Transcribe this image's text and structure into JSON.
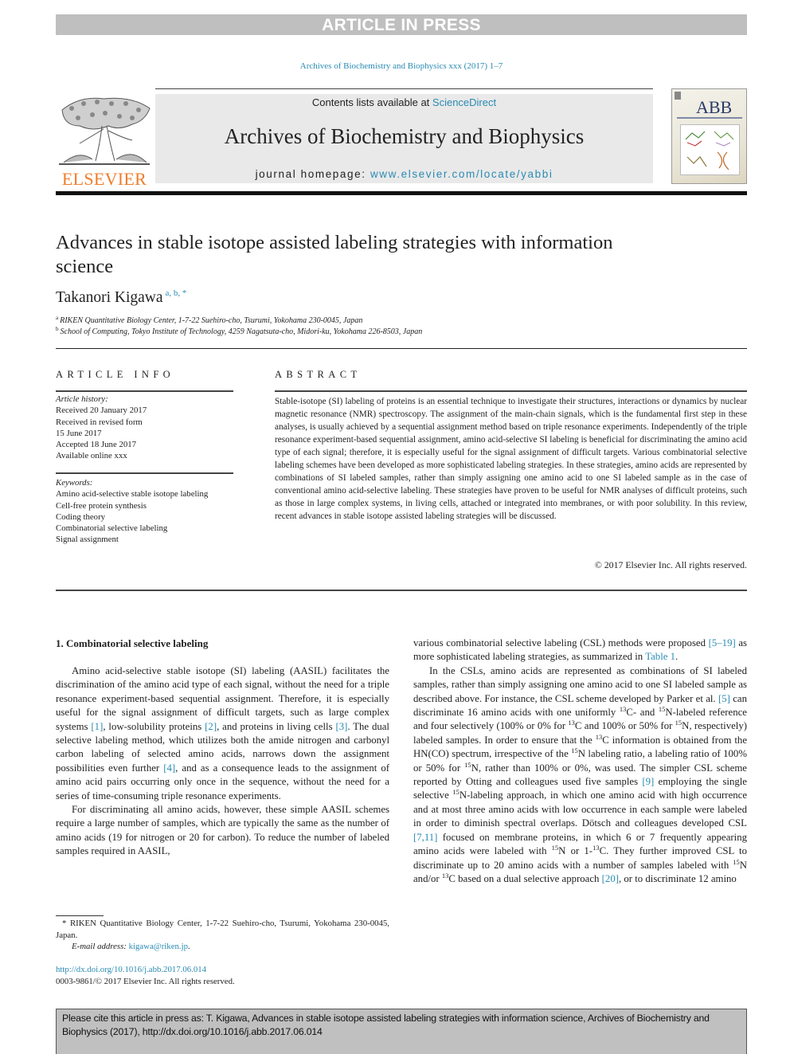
{
  "banner": {
    "text": "ARTICLE IN PRESS"
  },
  "journal_ref": "Archives of Biochemistry and Biophysics xxx (2017) 1–7",
  "header": {
    "contents_prefix": "Contents lists available at ",
    "contents_link": "ScienceDirect",
    "journal_name": "Archives of Biochemistry and Biophysics",
    "homepage_prefix": "journal homepage: ",
    "homepage_link": "www.elsevier.com/locate/yabbi",
    "publisher_logo_text": "ELSEVIER",
    "cover_title": "ABB"
  },
  "article": {
    "title": "Advances in stable isotope assisted labeling strategies with information science",
    "author": "Takanori Kigawa",
    "author_marks": "a, b, *",
    "affiliations": [
      {
        "mark": "a",
        "text": "RIKEN Quantitative Biology Center, 1-7-22 Suehiro-cho, Tsurumi, Yokohama 230-0045, Japan"
      },
      {
        "mark": "b",
        "text": "School of Computing, Tokyo Institute of Technology, 4259 Nagatsuta-cho, Midori-ku, Yokohama 226-8503, Japan"
      }
    ]
  },
  "article_info": {
    "heading": "ARTICLE INFO",
    "history_label": "Article history:",
    "history": [
      "Received 20 January 2017",
      "Received in revised form",
      "15 June 2017",
      "Accepted 18 June 2017",
      "Available online xxx"
    ],
    "keywords_label": "Keywords:",
    "keywords": [
      "Amino acid-selective stable isotope labeling",
      "Cell-free protein synthesis",
      "Coding theory",
      "Combinatorial selective labeling",
      "Signal assignment"
    ]
  },
  "abstract": {
    "heading": "ABSTRACT",
    "text": "Stable-isotope (SI) labeling of proteins is an essential technique to investigate their structures, interactions or dynamics by nuclear magnetic resonance (NMR) spectroscopy. The assignment of the main-chain signals, which is the fundamental first step in these analyses, is usually achieved by a sequential assignment method based on triple resonance experiments. Independently of the triple resonance experiment-based sequential assignment, amino acid-selective SI labeling is beneficial for discriminating the amino acid type of each signal; therefore, it is especially useful for the signal assignment of difficult targets. Various combinatorial selective labeling schemes have been developed as more sophisticated labeling strategies. In these strategies, amino acids are represented by combinations of SI labeled samples, rather than simply assigning one amino acid to one SI labeled sample as in the case of conventional amino acid-selective labeling. These strategies have proven to be useful for NMR analyses of difficult proteins, such as those in large complex systems, in living cells, attached or integrated into membranes, or with poor solubility. In this review, recent advances in stable isotope assisted labeling strategies will be discussed.",
    "copyright": "© 2017 Elsevier Inc. All rights reserved."
  },
  "section1": {
    "title": "1.  Combinatorial selective labeling",
    "left": {
      "p1_a": "Amino acid-selective stable isotope (SI) labeling (AASIL) facilitates the discrimination of the amino acid type of each signal, without the need for a triple resonance experiment-based sequential assignment. Therefore, it is especially useful for the signal assignment of difficult targets, such as large complex systems ",
      "ref1": "[1]",
      "p1_b": ", low-solubility proteins ",
      "ref2": "[2]",
      "p1_c": ", and proteins in living cells ",
      "ref3": "[3]",
      "p1_d": ". The dual selective labeling method, which utilizes both the amide nitrogen and carbonyl carbon labeling of selected amino acids, narrows down the assignment possibilities even further ",
      "ref4": "[4]",
      "p1_e": ", and as a consequence leads to the assignment of amino acid pairs occurring only once in the sequence, without the need for a series of time-consuming triple resonance experiments.",
      "p2": "For discriminating all amino acids, however, these simple AASIL schemes require a large number of samples, which are typically the same as the number of amino acids (19 for nitrogen or 20 for carbon). To reduce the number of labeled samples required in AASIL,"
    },
    "right": {
      "p1_a": "various combinatorial selective labeling (CSL) methods were proposed ",
      "ref5_19": "[5–19]",
      "p1_b": " as more sophisticated labeling strategies, as summarized in ",
      "table1": "Table 1",
      "p1_c": ".",
      "p2_a": "In the CSLs, amino acids are represented as combinations of SI labeled samples, rather than simply assigning one amino acid to one SI labeled sample as described above. For instance, the CSL scheme developed by Parker et al. ",
      "ref5": "[5]",
      "p2_b": " can discriminate 16 amino acids with one uniformly ",
      "p2_c": "C- and ",
      "p2_d": "N-labeled reference and four selectively (100% or 0% for ",
      "p2_e": "C and 100% or 50% for ",
      "p2_f": "N, respectively) labeled samples. In order to ensure that the ",
      "p2_g": "C information is obtained from the HN(CO) spectrum, irrespective of the ",
      "p2_h": "N labeling ratio, a labeling ratio of 100% or 50% for ",
      "p2_i": "N, rather than 100% or 0%, was used. The simpler CSL scheme reported by Otting and colleagues used five samples ",
      "ref9": "[9]",
      "p2_j": " employing the single selective ",
      "p2_k": "N-labeling approach, in which one amino acid with high occurrence and at most three amino acids with low occurrence in each sample were labeled in order to diminish spectral overlaps. Dötsch and colleagues developed CSL ",
      "ref7_11": "[7,11]",
      "p2_l": " focused on membrane proteins, in which 6 or 7 frequently appearing amino acids were labeled with ",
      "p2_m": "N or 1-",
      "p2_n": "C. They further improved CSL to discriminate up to 20 amino acids with a number of samples labeled with ",
      "p2_o": "N and/or ",
      "p2_p": "C based on a dual selective approach ",
      "ref20": "[20]",
      "p2_q": ", or to discriminate 12 amino",
      "iso_c": "13",
      "iso_n": "15"
    }
  },
  "footnote": {
    "mark": "*",
    "text": " RIKEN Quantitative Biology Center, 1-7-22 Suehiro-cho, Tsurumi, Yokohama 230-0045, Japan.",
    "email_label": "E-mail address: ",
    "email": "kigawa@riken.jp",
    "email_end": "."
  },
  "doi": "http://dx.doi.org/10.1016/j.abb.2017.06.014",
  "issn": "0003-9861/© 2017 Elsevier Inc. All rights reserved.",
  "citation": {
    "text": "Please cite this article in press as: T. Kigawa, Advances in stable isotope assisted labeling strategies with information science, Archives of Biochemistry and Biophysics (2017), http://dx.doi.org/10.1016/j.abb.2017.06.014"
  }
}
